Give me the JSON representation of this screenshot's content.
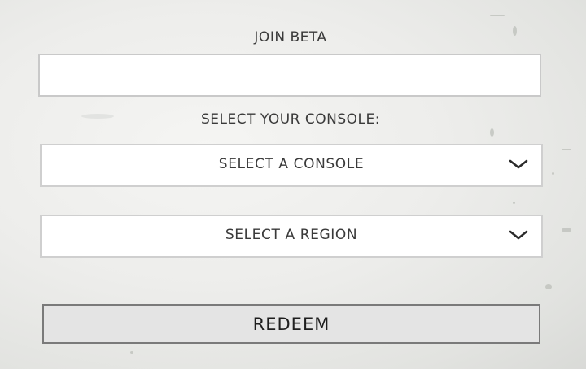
{
  "join": {
    "label": "JOIN BETA",
    "input_value": "",
    "input_placeholder": ""
  },
  "console": {
    "label": "SELECT YOUR CONSOLE:",
    "select_value": "SELECT A CONSOLE",
    "chevron_icon": "chevron-down-icon"
  },
  "region": {
    "select_value": "SELECT A REGION",
    "chevron_icon": "chevron-down-icon"
  },
  "redeem": {
    "label": "REDEEM"
  },
  "colors": {
    "background": "#ececea",
    "field": "#ffffff",
    "button": "#e4e4e4",
    "text": "#3a3a3a"
  }
}
